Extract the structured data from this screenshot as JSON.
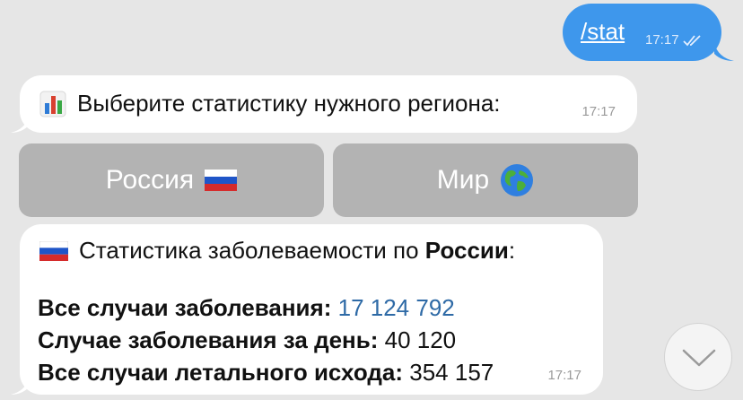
{
  "outgoing": {
    "text": "/stat",
    "time": "17:17",
    "status_icon": "double-check-icon"
  },
  "prompt_message": {
    "icon": "bar-chart-icon",
    "text": "Выберите статистику нужного региона:",
    "time": "17:17"
  },
  "keyboard": {
    "russia": {
      "label": "Россия",
      "icon": "russia-flag-icon"
    },
    "world": {
      "label": "Мир",
      "icon": "globe-icon"
    }
  },
  "stats_message": {
    "icon": "russia-flag-icon",
    "heading_prefix": "Статистика заболеваемости по",
    "heading_bold": "России",
    "heading_suffix": ":",
    "rows": [
      {
        "label": "Все случаи заболевания:",
        "value": "17 124 792"
      },
      {
        "label": "Случае заболевания за день:",
        "value": "40 120"
      },
      {
        "label": "Все случаи летального исхода:",
        "value": "354 157"
      }
    ],
    "time": "17:17"
  },
  "scroll_down": {
    "icon": "chevron-down-icon"
  },
  "colors": {
    "outgoing_bubble": "#3e97ec",
    "incoming_bubble": "#ffffff",
    "keyboard_button": "#b3b3b3",
    "link": "#2e6aa6"
  }
}
